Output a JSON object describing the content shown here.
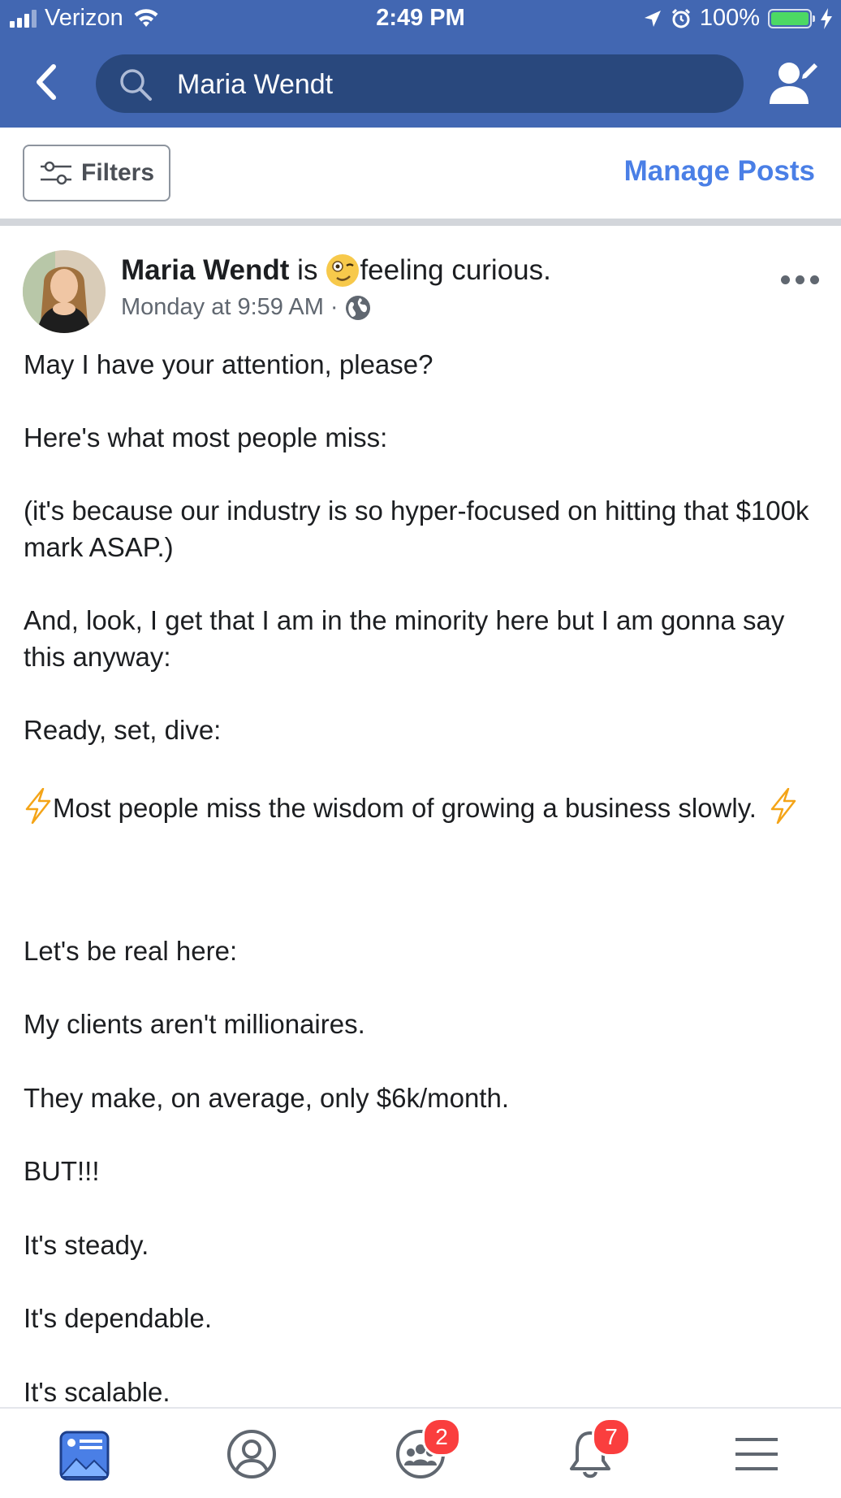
{
  "status_bar": {
    "carrier": "Verizon",
    "time": "2:49 PM",
    "battery_percent": "100%",
    "signal_bars": 4,
    "signal_bars_active": 3
  },
  "nav": {
    "search_query": "Maria Wendt",
    "back_icon": "chevron-left-icon",
    "search_icon": "search-icon",
    "friend_icon": "edit-profile-icon"
  },
  "filter_bar": {
    "filters_label": "Filters",
    "manage_posts_label": "Manage Posts"
  },
  "post": {
    "author": "Maria Wendt",
    "activity_verb": "is",
    "feeling": "feeling curious.",
    "timestamp": "Monday at 9:59 AM",
    "separator": "·",
    "audience_icon": "globe-icon",
    "paragraphs": [
      "May I have your attention, please?",
      "Here's what most people miss:",
      "(it's because our industry is so hyper-focused on hitting that $100k mark ASAP.)",
      "And, look, I get that I am in the minority here but I am gonna say this anyway:",
      "Ready, set, dive:",
      "Most people miss the wisdom of growing a business slowly.",
      "Let's be real here:",
      "My clients aren't millionaires.",
      "They make, on average, only $6k/month.",
      "BUT!!!",
      "It's steady.",
      "It's dependable.",
      "It's scalable."
    ]
  },
  "tab_bar": {
    "tabs": [
      {
        "name": "news-feed",
        "icon": "news-feed-icon",
        "active": true
      },
      {
        "name": "profile",
        "icon": "profile-icon"
      },
      {
        "name": "groups",
        "icon": "groups-icon",
        "badge": "2"
      },
      {
        "name": "notifications",
        "icon": "bell-icon",
        "badge": "7"
      },
      {
        "name": "menu",
        "icon": "menu-icon"
      }
    ]
  },
  "colors": {
    "brand_blue": "#4267b2",
    "search_bg": "#29487d",
    "link_blue": "#4a7fe6",
    "badge_red": "#fa3e3e",
    "battery_green": "#4cd964"
  }
}
